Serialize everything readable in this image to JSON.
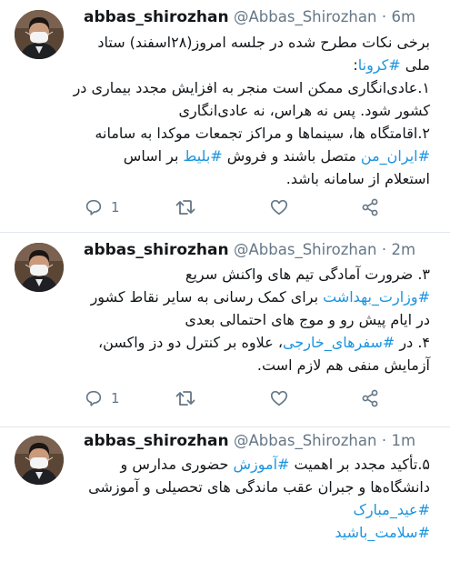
{
  "icons": {
    "reply": "reply-icon",
    "retweet": "retweet-icon",
    "like": "heart-icon",
    "share": "share-icon"
  },
  "colors": {
    "hashtag": "#1b95e0",
    "meta": "#657786",
    "text": "#14171a",
    "divider": "#e1e8ed"
  },
  "tweets": [
    {
      "name": "abbas_shirozhan",
      "handle": "@Abbas_Shirozhan",
      "separator": "·",
      "time": "6m",
      "lines": [
        [
          "برخی نکات مطرح شده در جلسه امروز(۲۸اسفند) ستاد"
        ],
        [
          "ملی ",
          "#کرونا",
          ":"
        ],
        [
          "۱.عادی‌انگاری ممکن است منجر به افزایش مجدد بیماری در"
        ],
        [
          "کشور شود. پس نه هراس، نه عادی‌انگاری"
        ],
        [
          "۲.اقامتگاه ها، سینماها و مراکز تجمعات موکدا به سامانه"
        ],
        [
          "#ایران_من",
          " متصل باشند و فروش ",
          "#بلیط",
          " بر اساس"
        ],
        [
          "استعلام از سامانه باشد."
        ]
      ],
      "reply_count": "1"
    },
    {
      "name": "abbas_shirozhan",
      "handle": "@Abbas_Shirozhan",
      "separator": "·",
      "time": "2m",
      "lines": [
        [
          "۳. ضرورت آمادگی تیم های واکنش سریع"
        ],
        [
          "#وزارت_بهداشت",
          " برای کمک رسانی به سایر نقاط کشور"
        ],
        [
          "در ایام پیش رو و موج های احتمالی بعدی"
        ],
        [
          "۴. در ",
          "#سفرهای_خارجی",
          "، علاوه بر کنترل دو دز واکسن،"
        ],
        [
          "آزمایش منفی هم لازم است."
        ]
      ],
      "reply_count": "1"
    },
    {
      "name": "abbas_shirozhan",
      "handle": "@Abbas_Shirozhan",
      "separator": "·",
      "time": "1m",
      "lines": [
        [
          "۵.تأکید مجدد بر اهمیت ",
          "#آموزش",
          " حضوری مدارس و"
        ],
        [
          "دانشگاه‌ها و جبران عقب ماندگی های تحصیلی و آموزشی"
        ],
        [
          "#عید_مبارک"
        ],
        [
          "#سلامت_باشید"
        ]
      ]
    }
  ]
}
